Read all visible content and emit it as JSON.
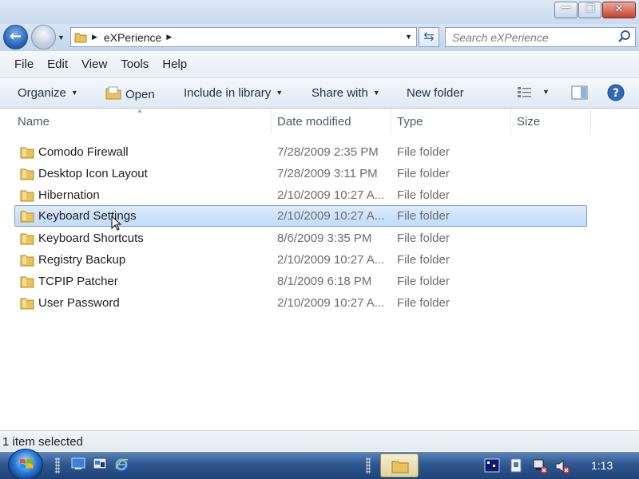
{
  "window": {
    "minimize": "—",
    "maximize": "❐",
    "close": "✕"
  },
  "address": {
    "back_arrow": "←",
    "forward_arrow": "→",
    "path": [
      "eXPerience"
    ],
    "search_placeholder": "Search eXPerience"
  },
  "menu": [
    "File",
    "Edit",
    "View",
    "Tools",
    "Help"
  ],
  "toolbar": {
    "organize": "Organize",
    "open": "Open",
    "include_in_library": "Include in library",
    "share_with": "Share with",
    "new_folder": "New folder"
  },
  "columns": {
    "name": "Name",
    "date_modified": "Date modified",
    "type": "Type",
    "size": "Size"
  },
  "files": [
    {
      "name": "Comodo Firewall",
      "date": "7/28/2009 2:35 PM",
      "type": "File folder",
      "selected": false
    },
    {
      "name": "Desktop Icon Layout",
      "date": "7/28/2009 3:11 PM",
      "type": "File folder",
      "selected": false
    },
    {
      "name": "Hibernation",
      "date": "2/10/2009 10:27 A...",
      "type": "File folder",
      "selected": false
    },
    {
      "name": "Keyboard Settings",
      "date": "2/10/2009 10:27 A...",
      "type": "File folder",
      "selected": true
    },
    {
      "name": "Keyboard Shortcuts",
      "date": "8/6/2009 3:35 PM",
      "type": "File folder",
      "selected": false
    },
    {
      "name": "Registry Backup",
      "date": "2/10/2009 10:27 A...",
      "type": "File folder",
      "selected": false
    },
    {
      "name": "TCPIP Patcher",
      "date": "8/1/2009 6:18 PM",
      "type": "File folder",
      "selected": false
    },
    {
      "name": "User Password",
      "date": "2/10/2009 10:27 A...",
      "type": "File folder",
      "selected": false
    }
  ],
  "status": {
    "text": "1 item selected"
  },
  "taskbar": {
    "clock": "1:13"
  },
  "colors": {
    "selection_fill": "#c8dffb",
    "selection_border": "#7da2ce",
    "taskbar": "#2f5791",
    "folder": "#e8c25a"
  }
}
